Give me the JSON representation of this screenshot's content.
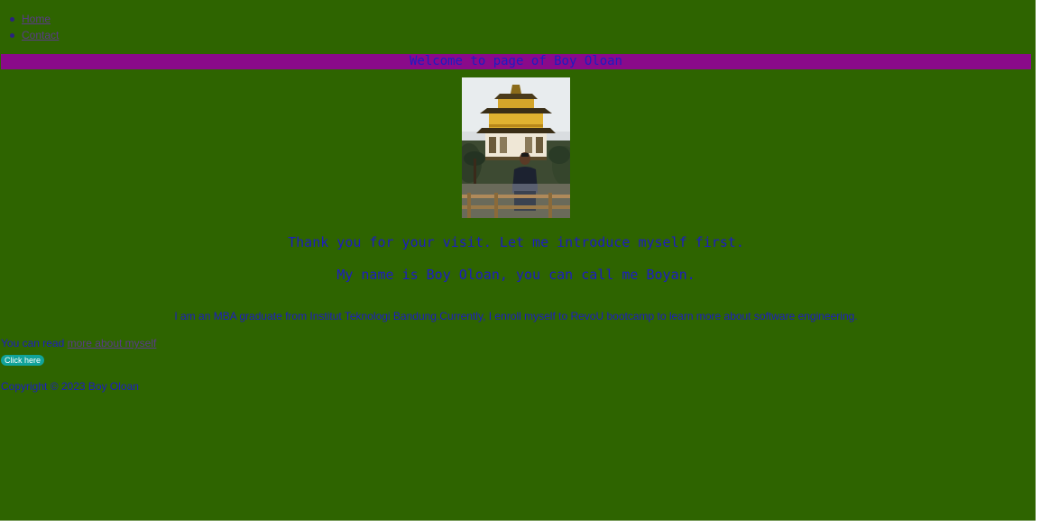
{
  "nav": {
    "items": [
      {
        "label": "Home"
      },
      {
        "label": "Contact"
      }
    ]
  },
  "banner": {
    "text": "Welcome to page of Boy Oloan"
  },
  "intro": {
    "line1": "Thank you for your visit. Let me introduce myself first.",
    "line2": "My name is Boy Oloan, you can call me Boyan."
  },
  "bio": {
    "text": "I am an MBA graduate from Institut Teknologi Bandung.Currently, I enroll myself to RevoU bootcamp to learn more about software engineering."
  },
  "read_more": {
    "prefix": "You can read ",
    "link_label": "more about myself"
  },
  "button": {
    "label": "Click here"
  },
  "footer": {
    "text": "Copyright © 2023 Boy Oloan"
  },
  "colors": {
    "page_background": "#2e6400",
    "banner_background": "#8a0a8a",
    "text_blue": "#1d1dc2",
    "link_purple": "#5a3a8a",
    "button_teal": "#11a39a"
  }
}
